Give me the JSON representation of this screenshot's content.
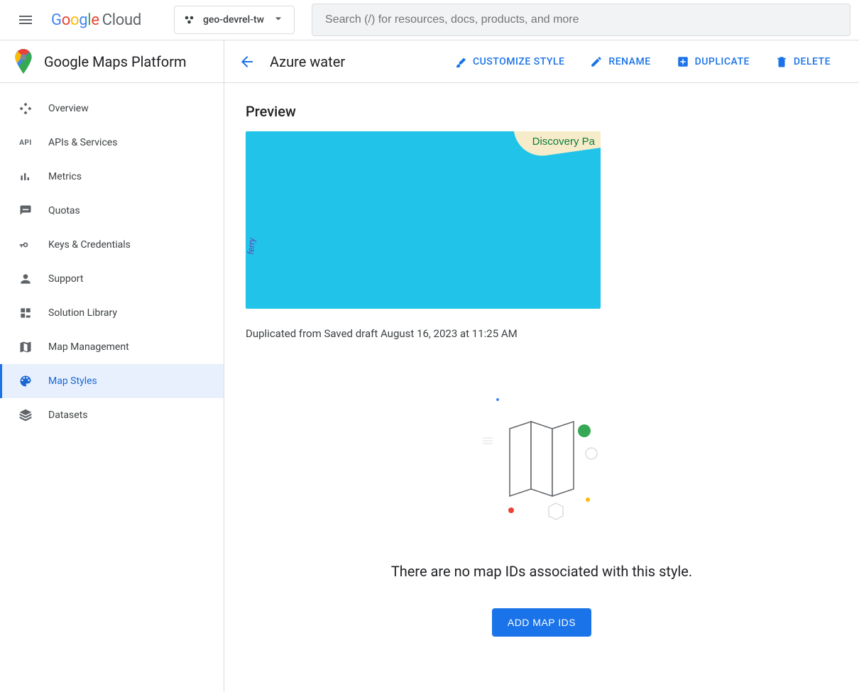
{
  "header": {
    "logo_text_google": "Google",
    "logo_text_cloud": "Cloud",
    "project_name": "geo-devrel-tw",
    "search_placeholder": "Search (/) for resources, docs, products, and more"
  },
  "sidebar": {
    "title": "Google Maps Platform",
    "items": [
      {
        "label": "Overview",
        "icon": "overview-icon",
        "active": false
      },
      {
        "label": "APIs & Services",
        "icon": "api-icon",
        "active": false
      },
      {
        "label": "Metrics",
        "icon": "metrics-icon",
        "active": false
      },
      {
        "label": "Quotas",
        "icon": "quotas-icon",
        "active": false
      },
      {
        "label": "Keys & Credentials",
        "icon": "keys-icon",
        "active": false
      },
      {
        "label": "Support",
        "icon": "support-icon",
        "active": false
      },
      {
        "label": "Solution Library",
        "icon": "solution-icon",
        "active": false
      },
      {
        "label": "Map Management",
        "icon": "map-management-icon",
        "active": false
      },
      {
        "label": "Map Styles",
        "icon": "map-styles-icon",
        "active": true
      },
      {
        "label": "Datasets",
        "icon": "datasets-icon",
        "active": false
      }
    ]
  },
  "page": {
    "title": "Azure water",
    "actions": {
      "customize": "CUSTOMIZE STYLE",
      "rename": "RENAME",
      "duplicate": "DUPLICATE",
      "delete": "DELETE"
    },
    "preview_label": "Preview",
    "map_place_label": "Discovery Pa",
    "ferry_label": "ferry",
    "meta": "Duplicated from Saved draft August 16, 2023 at 11:25 AM",
    "empty_text": "There are no map IDs associated with this style.",
    "add_button": "ADD MAP IDS"
  }
}
